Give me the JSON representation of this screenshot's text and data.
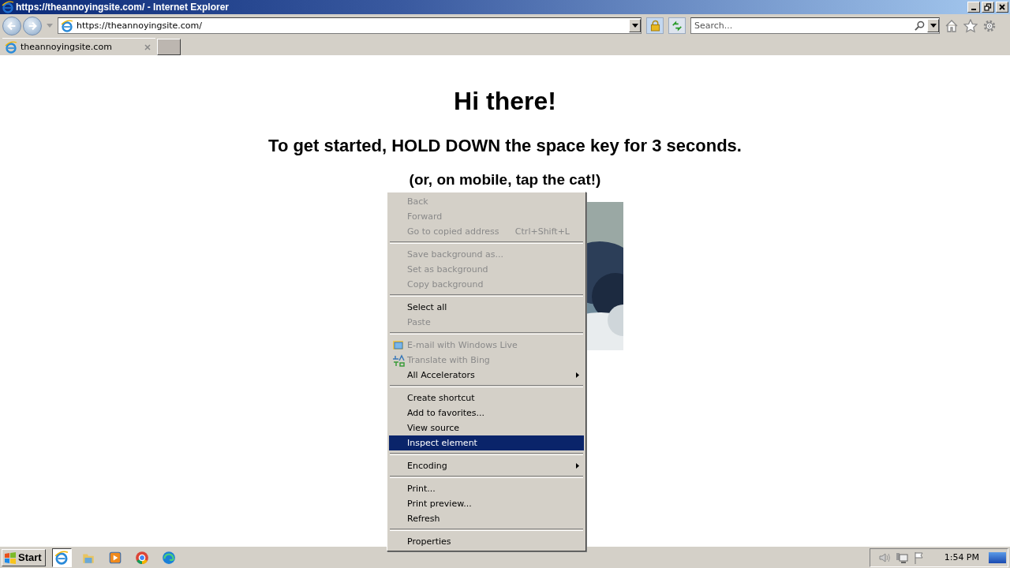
{
  "window": {
    "title": "https://theannoyingsite.com/ - Internet Explorer"
  },
  "address_bar": {
    "value": "https://theannoyingsite.com/"
  },
  "search": {
    "placeholder": "Search..."
  },
  "tabs": [
    {
      "label": "theannoyingsite.com"
    }
  ],
  "page": {
    "heading": "Hi there!",
    "instruction": "To get started, HOLD DOWN the space key for 3 seconds.",
    "mobile_hint": "(or, on mobile, tap the cat!)"
  },
  "context_menu": [
    {
      "kind": "item",
      "label": "Back",
      "disabled": true,
      "selected": false
    },
    {
      "kind": "item",
      "label": "Forward",
      "disabled": true,
      "selected": false
    },
    {
      "kind": "item",
      "label": "Go to copied address",
      "shortcut": "Ctrl+Shift+L",
      "disabled": true,
      "selected": false
    },
    {
      "kind": "separator"
    },
    {
      "kind": "item",
      "label": "Save background as...",
      "disabled": true,
      "selected": false
    },
    {
      "kind": "item",
      "label": "Set as background",
      "disabled": true,
      "selected": false
    },
    {
      "kind": "item",
      "label": "Copy background",
      "disabled": true,
      "selected": false
    },
    {
      "kind": "separator"
    },
    {
      "kind": "item",
      "label": "Select all",
      "disabled": false,
      "selected": false
    },
    {
      "kind": "item",
      "label": "Paste",
      "disabled": true,
      "selected": false
    },
    {
      "kind": "separator"
    },
    {
      "kind": "item",
      "label": "E-mail with Windows Live",
      "disabled": true,
      "selected": false,
      "icon": true
    },
    {
      "kind": "item",
      "label": "Translate with Bing",
      "disabled": true,
      "selected": false,
      "icon": true
    },
    {
      "kind": "item",
      "label": "All Accelerators",
      "disabled": false,
      "selected": false,
      "submenu": true
    },
    {
      "kind": "separator"
    },
    {
      "kind": "item",
      "label": "Create shortcut",
      "disabled": false,
      "selected": false
    },
    {
      "kind": "item",
      "label": "Add to favorites...",
      "disabled": false,
      "selected": false
    },
    {
      "kind": "item",
      "label": "View source",
      "disabled": false,
      "selected": false
    },
    {
      "kind": "item",
      "label": "Inspect element",
      "disabled": false,
      "selected": true
    },
    {
      "kind": "separator"
    },
    {
      "kind": "item",
      "label": "Encoding",
      "disabled": false,
      "selected": false,
      "submenu": true
    },
    {
      "kind": "separator"
    },
    {
      "kind": "item",
      "label": "Print...",
      "disabled": false,
      "selected": false
    },
    {
      "kind": "item",
      "label": "Print preview...",
      "disabled": false,
      "selected": false
    },
    {
      "kind": "item",
      "label": "Refresh",
      "disabled": false,
      "selected": false
    },
    {
      "kind": "separator"
    },
    {
      "kind": "item",
      "label": "Properties",
      "disabled": false,
      "selected": false
    }
  ],
  "taskbar": {
    "start": "Start",
    "apps": [
      {
        "kind": "ie",
        "selected": true
      },
      {
        "kind": "folder",
        "selected": false
      },
      {
        "kind": "media",
        "selected": false
      },
      {
        "kind": "chrome",
        "selected": false
      },
      {
        "kind": "edge",
        "selected": false
      }
    ],
    "clock": "1:54 PM"
  }
}
